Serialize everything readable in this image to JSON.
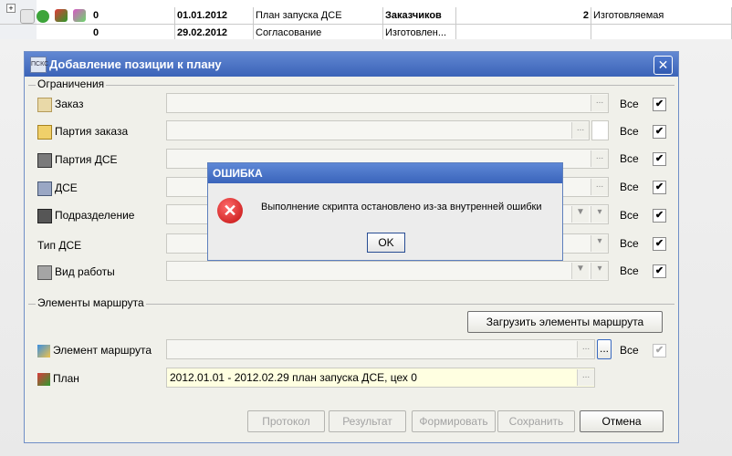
{
  "background_grid": {
    "rows": [
      {
        "c1": "0",
        "c2": "01.01.2012",
        "c3": "План запуска ДСЕ",
        "c4": "Заказчиков",
        "c5": "2",
        "c6": "Изготовляемая"
      },
      {
        "c1": "0",
        "c2": "29.02.2012",
        "c3": "Согласование",
        "c4": "Изготовлен...",
        "c5": "",
        "c6": ""
      }
    ]
  },
  "dialog": {
    "title": "Добавление позиции к плану",
    "icon_text": "ПСКС",
    "restrictions_group": "Ограничения",
    "rows": [
      {
        "label": "Заказ",
        "icon": "order-icon",
        "all_label": "Все",
        "checked": "✔"
      },
      {
        "label": "Партия заказа",
        "icon": "order-batch-icon",
        "all_label": "Все",
        "checked": "✔"
      },
      {
        "label": "Партия ДСЕ",
        "icon": "dse-batch-icon",
        "all_label": "Все",
        "checked": "✔"
      },
      {
        "label": "ДСЕ",
        "icon": "dse-icon",
        "all_label": "Все",
        "checked": "✔"
      },
      {
        "label": "Подразделение",
        "icon": "department-icon",
        "all_label": "Все",
        "checked": "✔"
      },
      {
        "label": "Тип ДСЕ",
        "icon": "",
        "all_label": "Все",
        "checked": "✔"
      },
      {
        "label": "Вид работы",
        "icon": "work-type-icon",
        "all_label": "Все",
        "checked": "✔"
      }
    ],
    "route_group": "Элементы маршрута",
    "load_route_button": "Загрузить элементы маршрута",
    "route_element_label": "Элемент маршрута",
    "route_element_all": "Все",
    "route_element_checked": "✔",
    "plan_label": "План",
    "plan_value": "2012.01.01 - 2012.02.29 план запуска ДСЕ, цех 0",
    "ellipsis": "...",
    "buttons": {
      "protocol": "Протокол",
      "result": "Результат",
      "form": "Формировать",
      "save": "Сохранить",
      "cancel": "Отмена"
    }
  },
  "error_dialog": {
    "title": "ОШИБКА",
    "message": "Выполнение скрипта остановлено из-за внутренней ошибки",
    "ok": "OK"
  }
}
